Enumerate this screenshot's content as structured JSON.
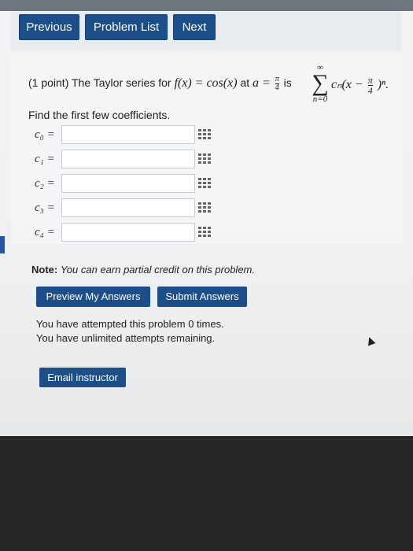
{
  "nav": {
    "previous": "Previous",
    "problem_list": "Problem List",
    "next": "Next"
  },
  "problem": {
    "points": "(1 point) The Taylor series for",
    "func": "f(x) = cos(x)",
    "at": "at",
    "a_eq": "a =",
    "pi": "π",
    "four": "4",
    "is": "is",
    "sum_upper": "∞",
    "sum_symbol": "∑",
    "sum_lower": "n=0",
    "term_start": "cₙ(x −",
    "term_end": ")ⁿ.",
    "instruction": "Find the first few coefficients."
  },
  "coefficients": [
    {
      "label": "c₀ =",
      "value": ""
    },
    {
      "label": "c₁ =",
      "value": ""
    },
    {
      "label": "c₂ =",
      "value": ""
    },
    {
      "label": "c₃ =",
      "value": ""
    },
    {
      "label": "c₄ =",
      "value": ""
    }
  ],
  "note": {
    "prefix": "Note:",
    "text": "You can earn partial credit on this problem."
  },
  "actions": {
    "preview": "Preview My Answers",
    "submit": "Submit Answers"
  },
  "status": {
    "attempted": "You have attempted this problem 0 times.",
    "remaining": "You have unlimited attempts remaining."
  },
  "email": "Email instructor",
  "icons": {
    "equation_editor": "grid-icon",
    "cursor": "mouse-cursor-icon"
  },
  "colors": {
    "button": "#1c4f8a"
  }
}
